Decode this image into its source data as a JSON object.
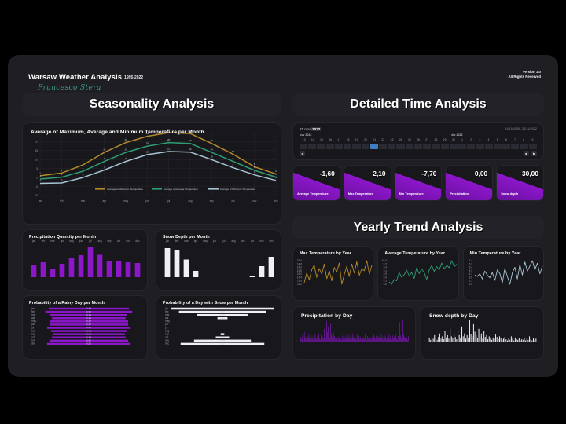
{
  "header": {
    "title": "Warsaw Weather Analysis",
    "years": "1995-2022",
    "subtitle": "Francesco Stera",
    "version": "Version 1.0",
    "rights": "All Rights Reserved"
  },
  "sections": {
    "seasonality": "Seasonality Analysis",
    "detailed": "Detailed Time Analysis",
    "yearly": "Yearly Trend Analysis"
  },
  "slicer": {
    "date_day": "21",
    "date_month": "nov",
    "date_year": "2022",
    "range_label": "01/01/1995 - 21/11/2022",
    "month_left": "nov 2022",
    "month_right": "dic 2022",
    "days": [
      "13",
      "14",
      "15",
      "16",
      "17",
      "18",
      "19",
      "20",
      "21",
      "22",
      "23",
      "24",
      "25",
      "26",
      "27",
      "28",
      "29",
      "30",
      "1",
      "2",
      "3",
      "4",
      "5",
      "6",
      "7",
      "8",
      "9"
    ],
    "selected_day": "21",
    "prev_icon": "chevron-left-icon",
    "stop_icon": "stop-icon",
    "next_icon": "chevron-right-icon"
  },
  "kpis": [
    {
      "label": "Average Temperature",
      "value": "-1,60"
    },
    {
      "label": "Max Temperature",
      "value": "2,10"
    },
    {
      "label": "Min Temperature",
      "value": "-7,70"
    },
    {
      "label": "Precipitation",
      "value": "0,00"
    },
    {
      "label": "Snow depth",
      "value": "30,00"
    }
  ],
  "cards": {
    "temp_month": "Average of Maximum, Average and Minimum Temperature per Month",
    "precip_month": "Precipitation Quantity per Month",
    "snow_month": "Snow Depth per Month",
    "rainy_prob": "Probability of a Rainy Day per Month",
    "snow_prob": "Probability of a Day with Snow per Month",
    "max_year": "Max Temperature by Year",
    "avg_year": "Average Temperature by Year",
    "min_year": "Min Temperature by Year",
    "precip_day": "Precipitation by Day",
    "snow_day": "Snow depth by Day"
  },
  "colors": {
    "max": "#b58a2b",
    "avg": "#2e9e74",
    "min": "#a9c4d4",
    "purple": "#8b17c9",
    "white": "#f0f0f4",
    "panel": "#17171c",
    "canvas": "#1e1e23"
  },
  "chart_data": [
    {
      "type": "line",
      "name": "temp_per_month",
      "title": "Average of Maximum, Average and Minimum Temperature per Month",
      "categories": [
        "jan",
        "feb",
        "mar",
        "apr",
        "may",
        "jun",
        "jul",
        "aug",
        "sep",
        "oct",
        "nov",
        "dec"
      ],
      "series": [
        {
          "name": "Average of Maximum Temperature",
          "color": "#b58a2b",
          "values": [
            1,
            2.5,
            7,
            14,
            19.5,
            23,
            25,
            24.5,
            19,
            13,
            6,
            2
          ]
        },
        {
          "name": "Average of Average Temperature",
          "color": "#2e9e74",
          "values": [
            -0.8,
            0.2,
            3.5,
            9,
            14,
            17.5,
            19.5,
            19,
            14,
            9,
            4,
            0.3
          ]
        },
        {
          "name": "Average of Minimum Temperature",
          "color": "#a9c4d4",
          "values": [
            -3.2,
            -3,
            0,
            4.2,
            9,
            12.8,
            14.5,
            14.2,
            10,
            5.5,
            1.5,
            -1.6
          ]
        }
      ],
      "ylabel": "",
      "xlabel": "",
      "ylim": [
        -10,
        25
      ],
      "grid": true,
      "legend": [
        "Average of Maximum Temperature",
        "Average of Average Temperature",
        "Average of Minimum Temperature"
      ]
    },
    {
      "type": "bar",
      "name": "precip_per_month",
      "title": "Precipitation Quantity per Month",
      "categories": [
        "jan",
        "feb",
        "mar",
        "apr",
        "may",
        "jun",
        "jul",
        "aug",
        "sep",
        "oct",
        "nov",
        "dec"
      ],
      "values": [
        32,
        38,
        22,
        34,
        50,
        56,
        78,
        57,
        42,
        40,
        38,
        36
      ],
      "color": "#8b17c9",
      "ylim": [
        0,
        80
      ]
    },
    {
      "type": "bar",
      "name": "snow_per_month",
      "title": "Snow Depth per Month",
      "categories": [
        "jan",
        "feb",
        "mar",
        "apr",
        "may",
        "jun",
        "jul",
        "aug",
        "sep",
        "oct",
        "nov",
        "dec"
      ],
      "values": [
        74,
        70,
        45,
        16,
        0,
        0,
        0,
        0,
        0,
        4,
        28,
        52
      ],
      "color": "#f0f0f4",
      "ylim": [
        0,
        80
      ]
    },
    {
      "type": "bar",
      "name": "rainy_probability",
      "orientation": "horizontal",
      "title": "Probability of a Rainy Day per Month",
      "categories": [
        "jan",
        "feb",
        "mar",
        "apr",
        "may",
        "jun",
        "jul",
        "aug",
        "sep",
        "oct",
        "nov",
        "dec"
      ],
      "values": [
        0.48,
        0.52,
        0.46,
        0.44,
        0.47,
        0.47,
        0.5,
        0.45,
        0.43,
        0.44,
        0.47,
        0.5
      ],
      "color": "#8b17c9"
    },
    {
      "type": "bar",
      "name": "snow_probability",
      "orientation": "horizontal",
      "title": "Probability of a Day with Snow per Month",
      "categories": [
        "jan",
        "feb",
        "mar",
        "apr",
        "may",
        "jun",
        "jul",
        "aug",
        "sep",
        "oct",
        "nov",
        "dec"
      ],
      "values": [
        0.62,
        0.52,
        0.3,
        0.06,
        0.0,
        0.0,
        0.0,
        0.0,
        0.02,
        0.08,
        0.34,
        0.5
      ],
      "color": "#f0f0f4"
    },
    {
      "type": "line",
      "name": "max_temp_by_year",
      "title": "Max Temperature by Year",
      "color": "#b58a2b",
      "values": [
        11.5,
        13.2,
        12.0,
        13.8,
        14.6,
        12.4,
        14.0,
        13.0,
        14.8,
        12.2,
        13.6,
        11.8,
        14.2,
        13.4,
        15.0,
        11.2,
        13.0,
        14.4,
        12.6,
        14.8,
        13.2,
        15.2,
        12.8,
        14.0,
        13.6,
        15.4,
        13.0,
        14.6
      ]
    },
    {
      "type": "line",
      "name": "avg_temp_by_year",
      "title": "Average Temperature by Year",
      "color": "#2e9e74",
      "values": [
        8.2,
        8.0,
        8.4,
        8.3,
        9.0,
        8.6,
        8.8,
        9.2,
        8.7,
        9.0,
        8.5,
        9.4,
        8.9,
        9.3,
        9.0,
        8.4,
        9.2,
        9.6,
        9.1,
        9.5,
        9.2,
        9.8,
        9.3,
        9.6,
        9.4,
        10.0,
        9.5,
        9.7
      ]
    },
    {
      "type": "line",
      "name": "min_temp_by_year",
      "title": "Min Temperature by Year",
      "color": "#a9c4d4",
      "values": [
        4.2,
        4.0,
        4.4,
        3.6,
        4.8,
        4.2,
        3.8,
        4.6,
        3.4,
        5.0,
        4.4,
        3.0,
        5.2,
        4.0,
        2.8,
        4.6,
        5.4,
        3.6,
        5.8,
        4.2,
        6.2,
        4.8,
        5.6,
        6.4,
        5.0,
        6.0,
        4.4,
        5.6
      ]
    },
    {
      "type": "bar",
      "name": "precipitation_by_day",
      "title": "Precipitation by Day",
      "color": "#8b17c9",
      "values": [
        4,
        6,
        3,
        9,
        5,
        2,
        14,
        7,
        4,
        3,
        8,
        5,
        11,
        6,
        3,
        9,
        4,
        7,
        2,
        6,
        10,
        5,
        3,
        8,
        4,
        12,
        6,
        3,
        9,
        5,
        7,
        4,
        18,
        8,
        5,
        30,
        14,
        22,
        9,
        6,
        26,
        11,
        7,
        4,
        13,
        8,
        5,
        10,
        6,
        3,
        7,
        4,
        9,
        5,
        2,
        8,
        4,
        11,
        6,
        3,
        9,
        5,
        7,
        4,
        10,
        6,
        3,
        8,
        5,
        12,
        7,
        4,
        9,
        6,
        3,
        10,
        5,
        8,
        4,
        7,
        3,
        9,
        5,
        6,
        4,
        11,
        7,
        3,
        8,
        5,
        9,
        4,
        6,
        3,
        7,
        5,
        10,
        6,
        4,
        8,
        3,
        9,
        5,
        7,
        4,
        6,
        11,
        5,
        3,
        8,
        4,
        9,
        6,
        3,
        7,
        5,
        10,
        4,
        8,
        6,
        3,
        9,
        5,
        7,
        4,
        11,
        6,
        3,
        8,
        5,
        28,
        9,
        6,
        4,
        32,
        12,
        7,
        5,
        10,
        6,
        3,
        8
      ]
    },
    {
      "type": "bar",
      "name": "snow_depth_by_day",
      "title": "Snow depth by Day",
      "color": "#f0f0f4",
      "values": [
        4,
        7,
        3,
        9,
        5,
        11,
        6,
        3,
        8,
        14,
        5,
        9,
        4,
        18,
        7,
        11,
        5,
        22,
        9,
        6,
        14,
        8,
        4,
        19,
        11,
        6,
        26,
        9,
        14,
        5,
        11,
        7,
        38,
        13,
        9,
        30,
        17,
        11,
        6,
        22,
        9,
        14,
        5,
        18,
        8,
        11,
        4,
        9,
        6,
        3,
        7,
        5,
        12,
        8,
        4,
        9,
        6,
        3,
        5,
        8,
        4,
        2,
        6,
        3,
        9,
        5,
        2,
        7,
        4,
        3,
        6,
        2,
        4,
        3,
        7,
        2,
        5,
        3,
        9,
        4,
        2,
        6,
        3,
        5
      ]
    }
  ]
}
